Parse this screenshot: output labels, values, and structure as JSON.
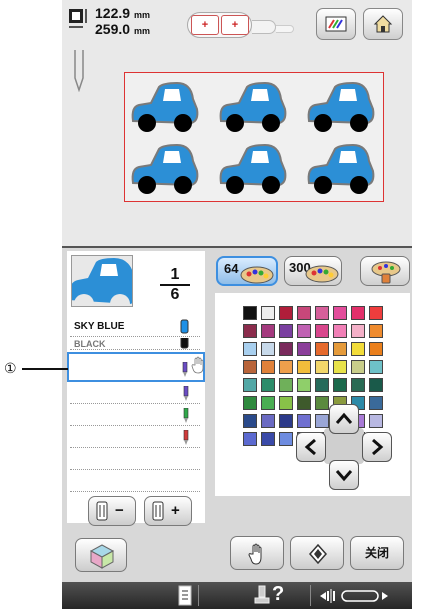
{
  "header": {
    "height_value": "122.9",
    "width_value": "259.0",
    "unit": "mm"
  },
  "thread_list": {
    "page_current": "1",
    "page_total": "6",
    "rows": [
      {
        "name": "SKY BLUE",
        "color": "#1e90e6"
      },
      {
        "name": "BLACK",
        "color": "#111111"
      }
    ],
    "spool_colors": [
      "#6a4cc4",
      "#6a4cc4",
      "#2fa84a",
      "#d03a3a"
    ]
  },
  "palette_tabs": [
    "64",
    "300",
    ""
  ],
  "swatches": [
    "#111111",
    "#eeeeee",
    "#b01e3a",
    "#c7477a",
    "#d65f9a",
    "#e34d9b",
    "#e2306a",
    "#ef3d3d",
    "#8b2c4c",
    "#a43a7e",
    "#7a3fa0",
    "#c061b3",
    "#d8468c",
    "#f07fb6",
    "#f4b0c8",
    "#ef8b2e",
    "#a9d0ef",
    "#c7d9ea",
    "#7a2a5c",
    "#8b3e9a",
    "#e66a2c",
    "#e59b3b",
    "#f2dc3a",
    "#ea7f1c",
    "#b8643a",
    "#e0813a",
    "#ef9f4c",
    "#f2bd3b",
    "#f2d66a",
    "#e8e24a",
    "#c9cd8a",
    "#6ec1c8",
    "#53a8a6",
    "#2c8c6a",
    "#6fb05a",
    "#8fcf6a",
    "#266a5a",
    "#1c6a4c",
    "#2a6a54",
    "#1a5a4a",
    "#2f8a3e",
    "#4aae52",
    "#88c248",
    "#3e5a2c",
    "#5a8a3e",
    "#8a9a3e",
    "#2c8aa8",
    "#3a6a9a",
    "#2a4a8a",
    "#6a6ac2",
    "#2c3a8a",
    "#6f6fd0",
    "#9aa6d6",
    "#8a6ad2",
    "#a87ad6",
    "#b8b8e2",
    "#5c6ad0",
    "#3a4aa8",
    "#6e8ce0",
    "#a4c0f0",
    "#2a3a7a",
    "#f0c070",
    "#f4a060",
    "#f0a0b0"
  ],
  "controls": {
    "close_label": "关闭"
  },
  "callout": {
    "marker": "①"
  }
}
